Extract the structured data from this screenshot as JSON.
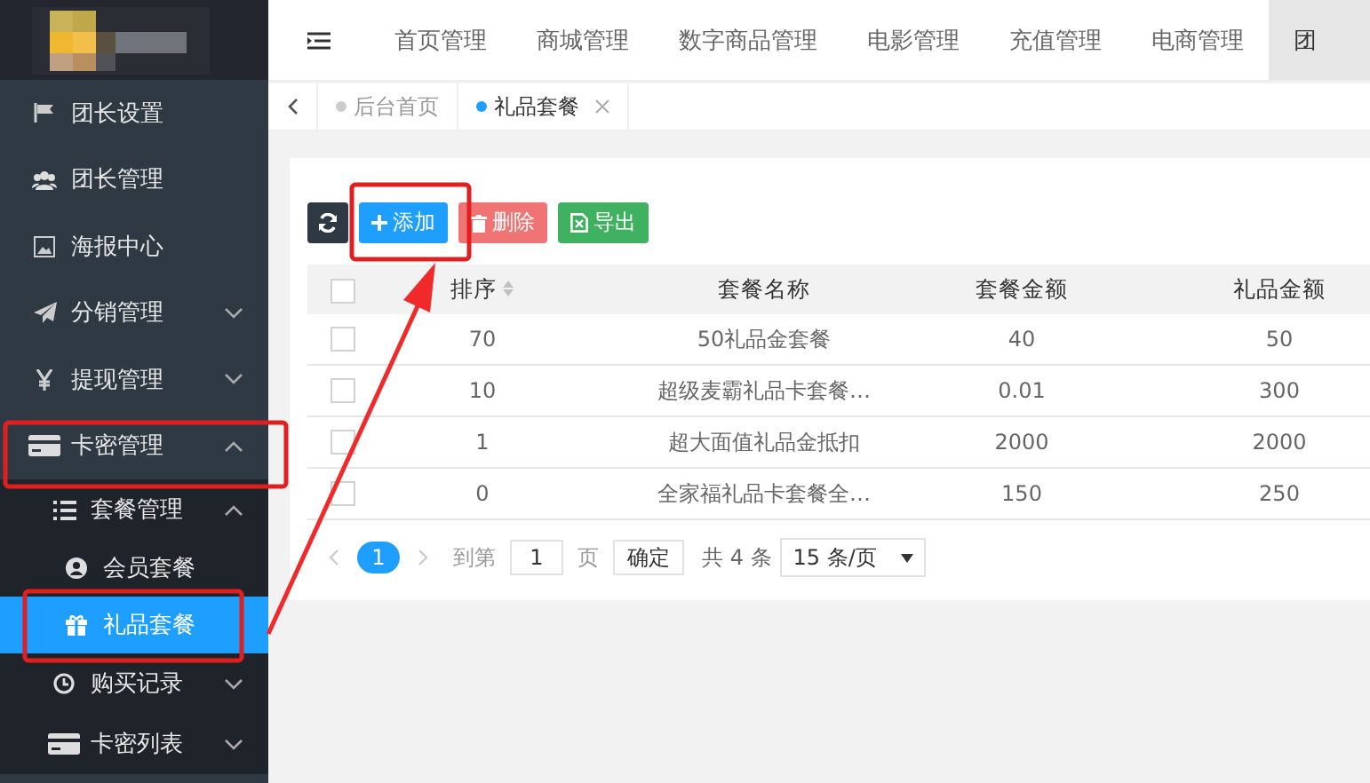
{
  "top_nav": {
    "items": [
      {
        "label": "首页管理",
        "selected": false
      },
      {
        "label": "商城管理",
        "selected": false
      },
      {
        "label": "数字商品管理",
        "selected": false
      },
      {
        "label": "电影管理",
        "selected": false
      },
      {
        "label": "充值管理",
        "selected": false
      },
      {
        "label": "电商管理",
        "selected": false
      },
      {
        "label": "团",
        "selected": true
      }
    ]
  },
  "sidebar": {
    "items": [
      {
        "label": "团长设置",
        "selected": false
      },
      {
        "label": "团长管理",
        "selected": false
      },
      {
        "label": "海报中心",
        "selected": false
      },
      {
        "label": "分销管理",
        "selected": false,
        "expanded": false
      },
      {
        "label": "提现管理",
        "selected": false,
        "expanded": false
      },
      {
        "label": "卡密管理",
        "selected": false,
        "expanded": true,
        "children": [
          {
            "label": "套餐管理",
            "selected": false,
            "expanded": true,
            "children": [
              {
                "label": "会员套餐",
                "selected": false
              },
              {
                "label": "礼品套餐",
                "selected": true
              }
            ]
          },
          {
            "label": "购买记录",
            "selected": false,
            "expanded": false
          },
          {
            "label": "卡密列表",
            "selected": false,
            "expanded": false
          }
        ]
      }
    ]
  },
  "page_tabs": [
    {
      "label": "后台首页",
      "selected": false
    },
    {
      "label": "礼品套餐",
      "selected": true
    }
  ],
  "toolbar": {
    "buttons": [
      {
        "kind": "refresh"
      },
      {
        "kind": "add",
        "label": "添加"
      },
      {
        "kind": "delete",
        "label": "删除"
      },
      {
        "kind": "export",
        "label": "导出"
      }
    ]
  },
  "table": {
    "all_checked": false,
    "columns": [
      "排序",
      "套餐名称",
      "套餐金额",
      "礼品金额"
    ],
    "rows": [
      {
        "checked": false,
        "cells": [
          "70",
          "50礼品金套餐",
          "40",
          "50"
        ]
      },
      {
        "checked": false,
        "cells": [
          "10",
          "超级麦霸礼品卡套餐…",
          "0.01",
          "300"
        ]
      },
      {
        "checked": false,
        "cells": [
          "1",
          "超大面值礼品金抵扣",
          "2000",
          "2000"
        ]
      },
      {
        "checked": false,
        "cells": [
          "0",
          "全家福礼品卡套餐全…",
          "150",
          "250"
        ]
      }
    ]
  },
  "pagination": {
    "pages": [
      {
        "label": "1",
        "selected": true
      }
    ],
    "goto_label": "到第",
    "goto_value": "1",
    "page_unit": "页",
    "confirm": "确定",
    "total": "共 4 条",
    "page_size": "15 条/页"
  }
}
